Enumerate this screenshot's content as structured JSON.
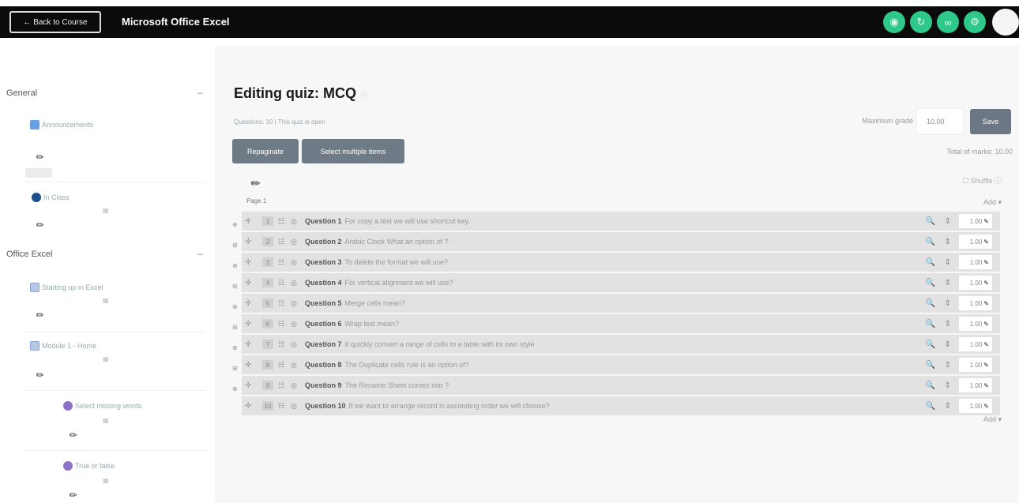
{
  "header": {
    "back_label": "← Back to Course",
    "app_title": "Microsoft Office Excel",
    "icons": [
      "view-icon",
      "refresh-icon",
      "link-icon",
      "settings-icon"
    ]
  },
  "sidebar": {
    "sections": [
      {
        "title": "General",
        "toggle": "–",
        "items": [
          {
            "label": "Announcements",
            "icon": "forum-icon"
          },
          {
            "label": "In Class",
            "icon": "globe-icon"
          }
        ]
      },
      {
        "title": "Office Excel",
        "toggle": "–",
        "items": [
          {
            "label": "Starting up in Excel",
            "icon": "page-icon"
          },
          {
            "label": "Module 1 - Home",
            "icon": "page-icon"
          },
          {
            "label": "Select missing words",
            "icon": "quiz-icon"
          },
          {
            "label": "True or false",
            "icon": "quiz-icon"
          }
        ]
      }
    ]
  },
  "main": {
    "title": "Editing quiz: MCQ",
    "info": "Questions: 10 | This quiz is open",
    "max_grade_label": "Maximum grade",
    "max_grade_value": "10.00",
    "save_label": "Save",
    "repaginate_label": "Repaginate",
    "select_multiple_label": "Select multiple items",
    "total_marks": "Total of marks: 10.00",
    "shuffle_label": "Shuffle",
    "page_label": "Page 1",
    "add_label": "Add ▾",
    "questions": [
      {
        "num": "1",
        "label": "Question 1",
        "text": "For copy a text we will use shortcut key.",
        "mark": "1.00"
      },
      {
        "num": "2",
        "label": "Question 2",
        "text": "Arabic Clock What an option of ?",
        "mark": "1.00"
      },
      {
        "num": "3",
        "label": "Question 3",
        "text": "To delete the format we will use?",
        "mark": "1.00"
      },
      {
        "num": "4",
        "label": "Question 4",
        "text": "For vertical alignment we will use?",
        "mark": "1.00"
      },
      {
        "num": "5",
        "label": "Question 5",
        "text": "Merge cells mean?",
        "mark": "1.00"
      },
      {
        "num": "6",
        "label": "Question 6",
        "text": "Wrap text mean?",
        "mark": "1.00"
      },
      {
        "num": "7",
        "label": "Question 7",
        "text": "It quickly convert a range of cells to a table with its own style",
        "mark": "1.00"
      },
      {
        "num": "8",
        "label": "Question 8",
        "text": "The Duplicate cells rule is an option of?",
        "mark": "1.00"
      },
      {
        "num": "9",
        "label": "Question 9",
        "text": "The Rename Sheet comes into ?",
        "mark": "1.00"
      },
      {
        "num": "10",
        "label": "Question 10",
        "text": "If we want to arrange record in ascending order we will choose?",
        "mark": "1.00"
      }
    ]
  }
}
